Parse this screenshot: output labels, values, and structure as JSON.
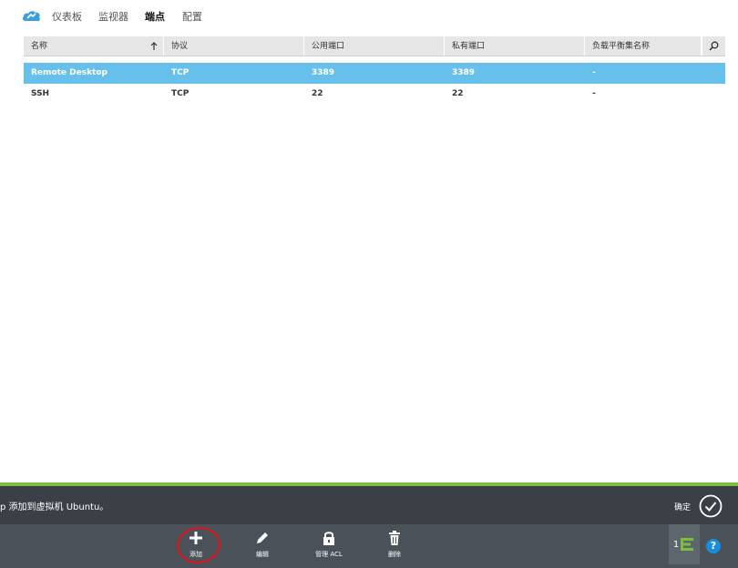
{
  "nav": {
    "tabs": [
      {
        "label": "仪表板"
      },
      {
        "label": "监视器"
      },
      {
        "label": "端点"
      },
      {
        "label": "配置"
      }
    ],
    "active_index": 2
  },
  "grid": {
    "columns": [
      "名称",
      "协议",
      "公用端口",
      "私有端口",
      "负载平衡集名称"
    ],
    "rows": [
      {
        "name": "Remote Desktop",
        "protocol": "TCP",
        "public_port": "3389",
        "private_port": "3389",
        "lb_set": "-"
      },
      {
        "name": "SSH",
        "protocol": "TCP",
        "public_port": "22",
        "private_port": "22",
        "lb_set": "-"
      }
    ],
    "selected_row": 0
  },
  "notification": {
    "message": "p 添加到虚拟机 Ubuntu。",
    "confirm_label": "确定"
  },
  "commands": {
    "add": "添加",
    "edit": "编辑",
    "manage_acl": "管理 ACL",
    "delete": "删除"
  },
  "status": {
    "count": "1"
  },
  "colors": {
    "selected_row": "#67c0ec",
    "accent_green": "#7bbf3e",
    "notify_bg": "#3a4046",
    "cmdbar_bg": "#4a5158",
    "help": "#1a8fd9",
    "annotation": "#e0141b"
  }
}
